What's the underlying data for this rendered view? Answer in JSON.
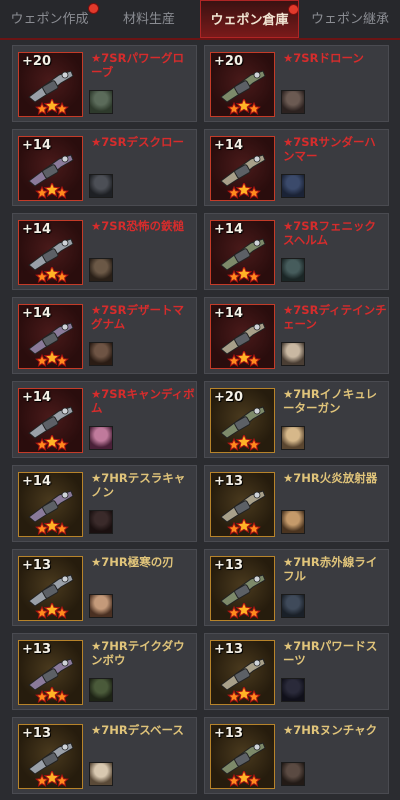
{
  "tabs": [
    {
      "label": "ウェポン作成",
      "badge": true,
      "active": false
    },
    {
      "label": "材料生産",
      "badge": false,
      "active": false
    },
    {
      "label": "ウェポン倉庫",
      "badge": true,
      "active": true
    },
    {
      "label": "ウェポン継承",
      "badge": false,
      "active": false
    }
  ],
  "weapons": [
    {
      "level": "+20",
      "name": "★7SRパワーグローブ",
      "rarity": "SR",
      "icon": "power-glove-icon"
    },
    {
      "level": "+20",
      "name": "★7SRドローン",
      "rarity": "SR",
      "icon": "drone-icon"
    },
    {
      "level": "+14",
      "name": "★7SRデスクロー",
      "rarity": "SR",
      "icon": "death-claw-icon"
    },
    {
      "level": "+14",
      "name": "★7SRサンダーハンマー",
      "rarity": "SR",
      "icon": "thunder-hammer-icon"
    },
    {
      "level": "+14",
      "name": "★7SR恐怖の鉄槌",
      "rarity": "SR",
      "icon": "spiked-mace-icon"
    },
    {
      "level": "+14",
      "name": "★7SRフェニックスヘルム",
      "rarity": "SR",
      "icon": "phoenix-helm-icon"
    },
    {
      "level": "+14",
      "name": "★7SRデザートマグナム",
      "rarity": "SR",
      "icon": "magnum-icon"
    },
    {
      "level": "+14",
      "name": "★7SRディテインチェーン",
      "rarity": "SR",
      "icon": "chain-icon"
    },
    {
      "level": "+14",
      "name": "★7SRキャンディボム",
      "rarity": "SR",
      "icon": "candy-bomb-icon"
    },
    {
      "level": "+20",
      "name": "★7HRイノキュレーターガン",
      "rarity": "HR",
      "icon": "inoculator-gun-icon"
    },
    {
      "level": "+14",
      "name": "★7HRテスラキャノン",
      "rarity": "HR",
      "icon": "tesla-cannon-icon"
    },
    {
      "level": "+13",
      "name": "★7HR火炎放射器",
      "rarity": "HR",
      "icon": "flamethrower-icon"
    },
    {
      "level": "+13",
      "name": "★7HR極寒の刃",
      "rarity": "HR",
      "icon": "frost-blade-icon"
    },
    {
      "level": "+13",
      "name": "★7HR赤外線ライフル",
      "rarity": "HR",
      "icon": "infrared-rifle-icon"
    },
    {
      "level": "+13",
      "name": "★7HRテイクダウンボウ",
      "rarity": "HR",
      "icon": "takedown-bow-icon"
    },
    {
      "level": "+13",
      "name": "★7HRパワードスーツ",
      "rarity": "HR",
      "icon": "powered-suit-icon"
    },
    {
      "level": "+13",
      "name": "★7HRデスベース",
      "rarity": "HR",
      "icon": "death-base-icon"
    },
    {
      "level": "+13",
      "name": "★7HRヌンチャク",
      "rarity": "HR",
      "icon": "nunchaku-icon"
    }
  ],
  "colors": {
    "sr": "#d62c2c",
    "hr": "#e0c47a",
    "badge": "#e23a2b",
    "accent": "#b02525"
  }
}
